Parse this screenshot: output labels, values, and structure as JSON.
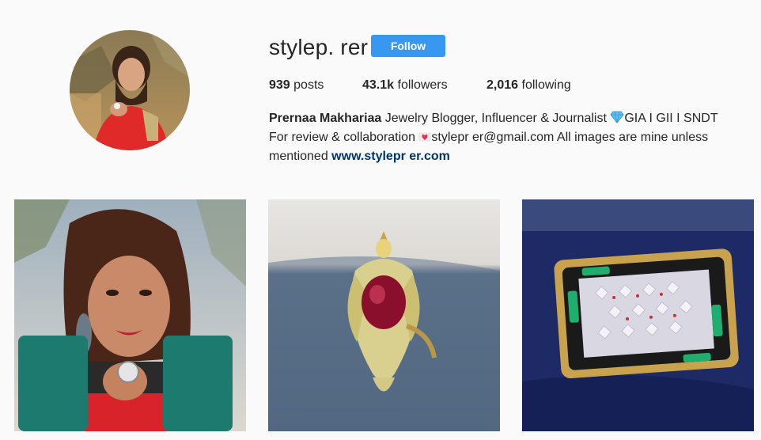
{
  "profile": {
    "username": "stylep. rer",
    "follow_label": "Follow",
    "stats": {
      "posts_count": "939",
      "posts_label": "posts",
      "followers_count": "43.1k",
      "followers_label": "followers",
      "following_count": "2,016",
      "following_label": "following"
    },
    "bio": {
      "name": "Prernaa Makhariaa",
      "line1_text": "Jewelry Blogger, Influencer & Journalist",
      "line1_suffix": "GIA I GII I SNDT",
      "line2_prefix": "For review & collaboration",
      "line2_email": "stylepr er@gmail.com All images are mine unless",
      "line3_prefix": "mentioned",
      "website": "www.stylepr er.com"
    }
  },
  "colors": {
    "follow_button": "#3897f0",
    "link": "#003569",
    "background": "#fafafa"
  },
  "posts": [
    {
      "icon": "portrait-dumbbell-photo"
    },
    {
      "icon": "bird-ring-photo"
    },
    {
      "icon": "jeweled-box-photo"
    }
  ]
}
